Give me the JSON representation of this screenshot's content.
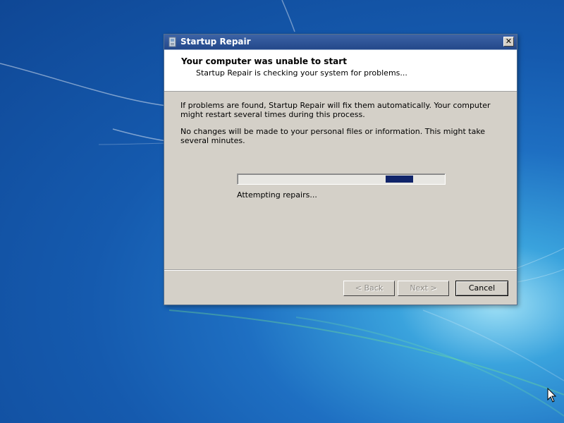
{
  "window": {
    "title": "Startup Repair",
    "icon": "startup-repair-icon",
    "close_glyph": "✕"
  },
  "header": {
    "title": "Your computer was unable to start",
    "subtitle": "Startup Repair is checking your system for problems..."
  },
  "body": {
    "paragraph1": "If problems are found, Startup Repair will fix them automatically. Your computer might restart several times during this process.",
    "paragraph2": "No changes will be made to your personal files or information. This might take several minutes."
  },
  "progress": {
    "mode": "marquee",
    "status": "Attempting repairs..."
  },
  "buttons": {
    "back": "< Back",
    "next": "Next >",
    "cancel": "Cancel"
  },
  "colors": {
    "titlebar": "#23488a",
    "progress_chunk": "#10246a",
    "dialog_bg": "#d4d0c8",
    "desktop": "#155aae"
  }
}
